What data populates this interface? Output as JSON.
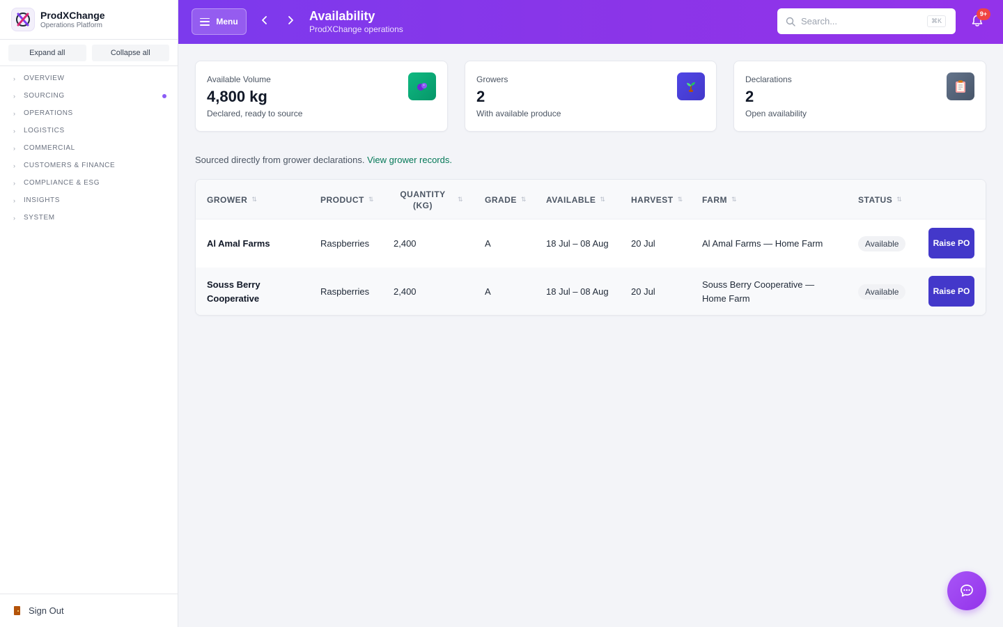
{
  "brand": {
    "name": "ProdXChange",
    "subtitle": "Operations Platform"
  },
  "sidebar": {
    "expand_all": "Expand all",
    "collapse_all": "Collapse all",
    "items": [
      {
        "label": "OVERVIEW"
      },
      {
        "label": "SOURCING",
        "has_indicator": true
      },
      {
        "label": "OPERATIONS"
      },
      {
        "label": "LOGISTICS"
      },
      {
        "label": "COMMERCIAL"
      },
      {
        "label": "CUSTOMERS & FINANCE"
      },
      {
        "label": "COMPLIANCE & ESG"
      },
      {
        "label": "INSIGHTS"
      },
      {
        "label": "SYSTEM"
      }
    ],
    "sign_out": "Sign Out"
  },
  "header": {
    "menu_label": "Menu",
    "title": "Availability",
    "subtitle": "ProdXChange operations",
    "search_placeholder": "Search...",
    "search_shortcut": "⌘K",
    "notification_count": "9+"
  },
  "stats": [
    {
      "label": "Available Volume",
      "value": "4,800 kg",
      "sub": "Declared, ready to source",
      "icon": "blueberry-icon",
      "color": "#10b981"
    },
    {
      "label": "Growers",
      "value": "2",
      "sub": "With available produce",
      "icon": "seedling-icon",
      "color": "#4f46e5"
    },
    {
      "label": "Declarations",
      "value": "2",
      "sub": "Open availability",
      "icon": "clipboard-icon",
      "color": "#4b5563"
    }
  ],
  "note": {
    "text": "Sourced directly from grower declarations. ",
    "link": "View grower records."
  },
  "table": {
    "columns": [
      "GROWER",
      "PRODUCT",
      "QUANTITY (KG)",
      "GRADE",
      "AVAILABLE",
      "HARVEST",
      "FARM",
      "STATUS"
    ],
    "rows": [
      {
        "grower": "Al Amal Farms",
        "product": "Raspberries",
        "quantity": "2,400",
        "grade": "A",
        "available": "18 Jul – 08 Aug",
        "harvest": "20 Jul",
        "farm": "Al Amal Farms — Home Farm",
        "status": "Available",
        "action": "Raise PO"
      },
      {
        "grower": "Souss Berry Cooperative",
        "product": "Raspberries",
        "quantity": "2,400",
        "grade": "A",
        "available": "18 Jul – 08 Aug",
        "harvest": "20 Jul",
        "farm": "Souss Berry Cooperative — Home Farm",
        "status": "Available",
        "action": "Raise PO"
      }
    ]
  },
  "colors": {
    "header_gradient_start": "#7c3aed",
    "header_gradient_end": "#9333ea",
    "primary_button": "#4338ca",
    "link": "#047857",
    "badge": "#ef4444"
  }
}
